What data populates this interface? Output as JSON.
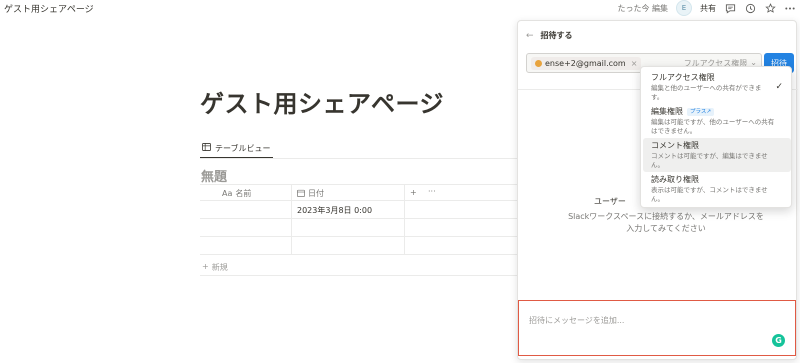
{
  "topbar": {
    "breadcrumb": "ゲスト用シェアページ",
    "edited": "たった今 編集",
    "avatar_initial": "E",
    "share_label": "共有"
  },
  "page": {
    "title": "ゲスト用シェアページ",
    "view_tab_label": "テーブルビュー",
    "database_title": "無題",
    "columns": [
      {
        "icon": "Aa",
        "label": "名前"
      },
      {
        "icon": "calendar-icon",
        "label": "日付"
      }
    ],
    "add_column_symbol": "+",
    "more_symbol": "···",
    "rows": [
      {
        "name": "",
        "date": "2023年3月8日 0:00"
      },
      {
        "name": "",
        "date": ""
      },
      {
        "name": "",
        "date": ""
      }
    ],
    "new_row_label": "新規"
  },
  "share_panel": {
    "header_title": "招待する",
    "invitee_chip": "ense+2@gmail.com",
    "permission_selected": "フルアクセス権限",
    "invite_button": "招待",
    "empty_title": "ユーザー",
    "empty_desc_line1": "Slackワークスペースに接続するか、メールアドレスを",
    "empty_desc_line2": "入力してみてください",
    "message_placeholder": "招待にメッセージを追加..."
  },
  "permission_dropdown": {
    "options": [
      {
        "title": "フルアクセス権限",
        "desc_line1": "編集と他のユーザーへの共有ができま",
        "desc_line2": "す。",
        "badge": "",
        "selected": true
      },
      {
        "title": "編集権限",
        "desc_line1": "編集は可能ですが、他のユーザーへの共有",
        "desc_line2": "はできません。",
        "badge": "プラス↗",
        "selected": false
      },
      {
        "title": "コメント権限",
        "desc_line1": "コメントは可能ですが、編集はできませ",
        "desc_line2": "ん。",
        "badge": "",
        "selected": false
      },
      {
        "title": "読み取り権限",
        "desc_line1": "表示は可能ですが、コメントはできませ",
        "desc_line2": "ん。",
        "badge": "",
        "selected": false
      }
    ]
  },
  "colors": {
    "accent": "#2383e2",
    "highlight_border": "#e05a44"
  }
}
